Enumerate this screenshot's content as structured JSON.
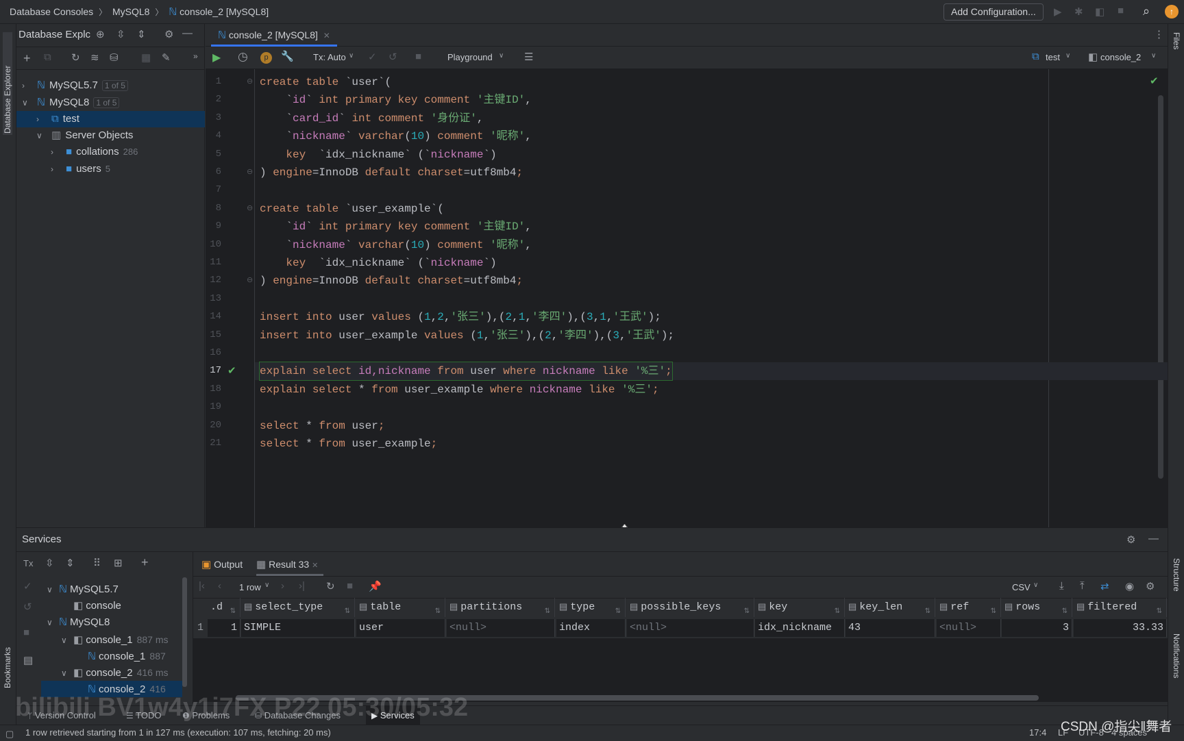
{
  "titlebar": {
    "breadcrumb": [
      "Database Consoles",
      "MySQL8",
      "console_2 [MySQL8]"
    ],
    "add_configuration": "Add Configuration..."
  },
  "left_strip": {
    "database_explorer": "Database Explorer",
    "bookmarks": "Bookmarks"
  },
  "right_strip": {
    "files": "Files",
    "structure": "Structure",
    "notifications": "Notifications"
  },
  "db_explorer": {
    "title": "Database Explc",
    "tree": [
      {
        "label": "MySQL5.7",
        "badge": "1 of 5",
        "depth": 0,
        "expanded": false
      },
      {
        "label": "MySQL8",
        "badge": "1 of 5",
        "depth": 0,
        "expanded": true
      },
      {
        "label": "test",
        "depth": 1,
        "expanded": false,
        "selected": true
      },
      {
        "label": "Server Objects",
        "depth": 1,
        "expanded": true
      },
      {
        "label": "collations",
        "count": "286",
        "depth": 2,
        "expanded": false
      },
      {
        "label": "users",
        "count": "5",
        "depth": 2,
        "expanded": false
      }
    ]
  },
  "editor_tab": {
    "label": "console_2 [MySQL8]"
  },
  "toolbar": {
    "tx": "Tx: Auto",
    "playground": "Playground",
    "schema": "test",
    "session": "console_2"
  },
  "editor": {
    "current_line": 17,
    "lines": [
      [
        [
          "kw",
          "create table "
        ],
        [
          "p",
          "`user`("
        ]
      ],
      [
        [
          "p",
          "    `"
        ],
        [
          "id",
          "id"
        ],
        [
          "p",
          "` "
        ],
        [
          "kw",
          "int primary key comment "
        ],
        [
          "str",
          "'主键ID'"
        ],
        [
          "p",
          ","
        ]
      ],
      [
        [
          "p",
          "    `"
        ],
        [
          "id",
          "card_id"
        ],
        [
          "p",
          "` "
        ],
        [
          "kw",
          "int comment "
        ],
        [
          "str",
          "'身份证'"
        ],
        [
          "p",
          ","
        ]
      ],
      [
        [
          "p",
          "    `"
        ],
        [
          "id",
          "nickname"
        ],
        [
          "p",
          "` "
        ],
        [
          "kw",
          "varchar"
        ],
        [
          "p",
          "("
        ],
        [
          "num",
          "10"
        ],
        [
          "p",
          ") "
        ],
        [
          "kw",
          "comment "
        ],
        [
          "str",
          "'昵称'"
        ],
        [
          "p",
          ","
        ]
      ],
      [
        [
          "p",
          "    "
        ],
        [
          "kw",
          "key"
        ],
        [
          "p",
          "  `idx_nickname` (`"
        ],
        [
          "id",
          "nickname"
        ],
        [
          "p",
          "`)"
        ]
      ],
      [
        [
          "p",
          ") "
        ],
        [
          "kw",
          "engine"
        ],
        [
          "p",
          "=InnoDB "
        ],
        [
          "kw",
          "default charset"
        ],
        [
          "p",
          "=utf8mb4"
        ],
        [
          "kw",
          ";"
        ]
      ],
      [],
      [
        [
          "kw",
          "create table "
        ],
        [
          "p",
          "`user_example`("
        ]
      ],
      [
        [
          "p",
          "    `"
        ],
        [
          "id",
          "id"
        ],
        [
          "p",
          "` "
        ],
        [
          "kw",
          "int primary key comment "
        ],
        [
          "str",
          "'主键ID'"
        ],
        [
          "p",
          ","
        ]
      ],
      [
        [
          "p",
          "    `"
        ],
        [
          "id",
          "nickname"
        ],
        [
          "p",
          "` "
        ],
        [
          "kw",
          "varchar"
        ],
        [
          "p",
          "("
        ],
        [
          "num",
          "10"
        ],
        [
          "p",
          ") "
        ],
        [
          "kw",
          "comment "
        ],
        [
          "str",
          "'昵称'"
        ],
        [
          "p",
          ","
        ]
      ],
      [
        [
          "p",
          "    "
        ],
        [
          "kw",
          "key"
        ],
        [
          "p",
          "  `idx_nickname` (`"
        ],
        [
          "id",
          "nickname"
        ],
        [
          "p",
          "`)"
        ]
      ],
      [
        [
          "p",
          ") "
        ],
        [
          "kw",
          "engine"
        ],
        [
          "p",
          "=InnoDB "
        ],
        [
          "kw",
          "default charset"
        ],
        [
          "p",
          "=utf8mb4"
        ],
        [
          "kw",
          ";"
        ]
      ],
      [],
      [
        [
          "kw",
          "insert into "
        ],
        [
          "p",
          "user "
        ],
        [
          "kw",
          "values "
        ],
        [
          "p",
          "("
        ],
        [
          "num",
          "1"
        ],
        [
          "p",
          ","
        ],
        [
          "num",
          "2"
        ],
        [
          "p",
          ","
        ],
        [
          "str",
          "'张三'"
        ],
        [
          "p",
          "),("
        ],
        [
          "num",
          "2"
        ],
        [
          "p",
          ","
        ],
        [
          "num",
          "1"
        ],
        [
          "p",
          ","
        ],
        [
          "str",
          "'李四'"
        ],
        [
          "p",
          "),("
        ],
        [
          "num",
          "3"
        ],
        [
          "p",
          ","
        ],
        [
          "num",
          "1"
        ],
        [
          "p",
          ","
        ],
        [
          "str",
          "'王武'"
        ],
        [
          "p",
          ");"
        ]
      ],
      [
        [
          "kw",
          "insert into "
        ],
        [
          "p",
          "user_example "
        ],
        [
          "kw",
          "values "
        ],
        [
          "p",
          "("
        ],
        [
          "num",
          "1"
        ],
        [
          "p",
          ","
        ],
        [
          "str",
          "'张三'"
        ],
        [
          "p",
          "),("
        ],
        [
          "num",
          "2"
        ],
        [
          "p",
          ","
        ],
        [
          "str",
          "'李四'"
        ],
        [
          "p",
          "),("
        ],
        [
          "num",
          "3"
        ],
        [
          "p",
          ","
        ],
        [
          "str",
          "'王武'"
        ],
        [
          "p",
          ");"
        ]
      ],
      [],
      [
        [
          "kw",
          "explain select "
        ],
        [
          "id",
          "id,nickname "
        ],
        [
          "kw",
          "from "
        ],
        [
          "p",
          "user "
        ],
        [
          "kw",
          "where "
        ],
        [
          "id",
          "nickname "
        ],
        [
          "kw",
          "like "
        ],
        [
          "str",
          "'%三'"
        ],
        [
          "kw",
          ";"
        ]
      ],
      [
        [
          "kw",
          "explain select "
        ],
        [
          "p",
          "* "
        ],
        [
          "kw",
          "from "
        ],
        [
          "p",
          "user_example "
        ],
        [
          "kw",
          "where "
        ],
        [
          "id",
          "nickname "
        ],
        [
          "kw",
          "like "
        ],
        [
          "str",
          "'%三'"
        ],
        [
          "kw",
          ";"
        ]
      ],
      [],
      [
        [
          "kw",
          "select "
        ],
        [
          "p",
          "* "
        ],
        [
          "kw",
          "from "
        ],
        [
          "p",
          "user"
        ],
        [
          "kw",
          ";"
        ]
      ],
      [
        [
          "kw",
          "select "
        ],
        [
          "p",
          "* "
        ],
        [
          "kw",
          "from "
        ],
        [
          "p",
          "user_example"
        ],
        [
          "kw",
          ";"
        ]
      ]
    ]
  },
  "services": {
    "title": "Services",
    "tree": [
      {
        "label": "MySQL5.7",
        "depth": 0
      },
      {
        "label": "console",
        "depth": 1
      },
      {
        "label": "MySQL8",
        "depth": 0
      },
      {
        "label": "console_1",
        "time": "887 ms",
        "depth": 1
      },
      {
        "label": "console_1",
        "time": "887",
        "depth": 2
      },
      {
        "label": "console_2",
        "time": "416 ms",
        "depth": 1
      },
      {
        "label": "console_2",
        "time": "416",
        "depth": 2,
        "selected": true
      }
    ],
    "tabs": [
      {
        "label": "Output"
      },
      {
        "label": "Result 33",
        "active": true
      }
    ],
    "rows_selector": "1 row",
    "export_format": "CSV",
    "columns": [
      ".d",
      "select_type",
      "table",
      "partitions",
      "type",
      "possible_keys",
      "key",
      "key_len",
      "ref",
      "rows",
      "filtered"
    ],
    "rows": [
      {
        "num": "1",
        "cells": [
          "1",
          "SIMPLE",
          "user",
          "<null>",
          "index",
          "<null>",
          "idx_nickname",
          "43",
          "<null>",
          "3",
          "33.33"
        ]
      }
    ]
  },
  "bottom_tabs": [
    "Version Control",
    "TODO",
    "Problems",
    "Database Changes",
    "Services"
  ],
  "statusbar": {
    "message": "1 row retrieved starting from 1 in 127 ms (execution: 107 ms, fetching: 20 ms)",
    "position": "17:4",
    "line_sep": "LF",
    "encoding": "UTF-8",
    "indent": "4 spaces"
  },
  "watermark": {
    "left": "bilibili BV1w4y1i7FX P22 05:30/05:32",
    "right": "CSDN @指尖‖舞者"
  },
  "colors": {
    "accent": "#3574f0",
    "selection": "#0f3457",
    "keyword": "#cf8e6d",
    "string": "#6aab73",
    "number": "#2aacb8",
    "identifier": "#c77dbb",
    "success": "#5fb865"
  }
}
